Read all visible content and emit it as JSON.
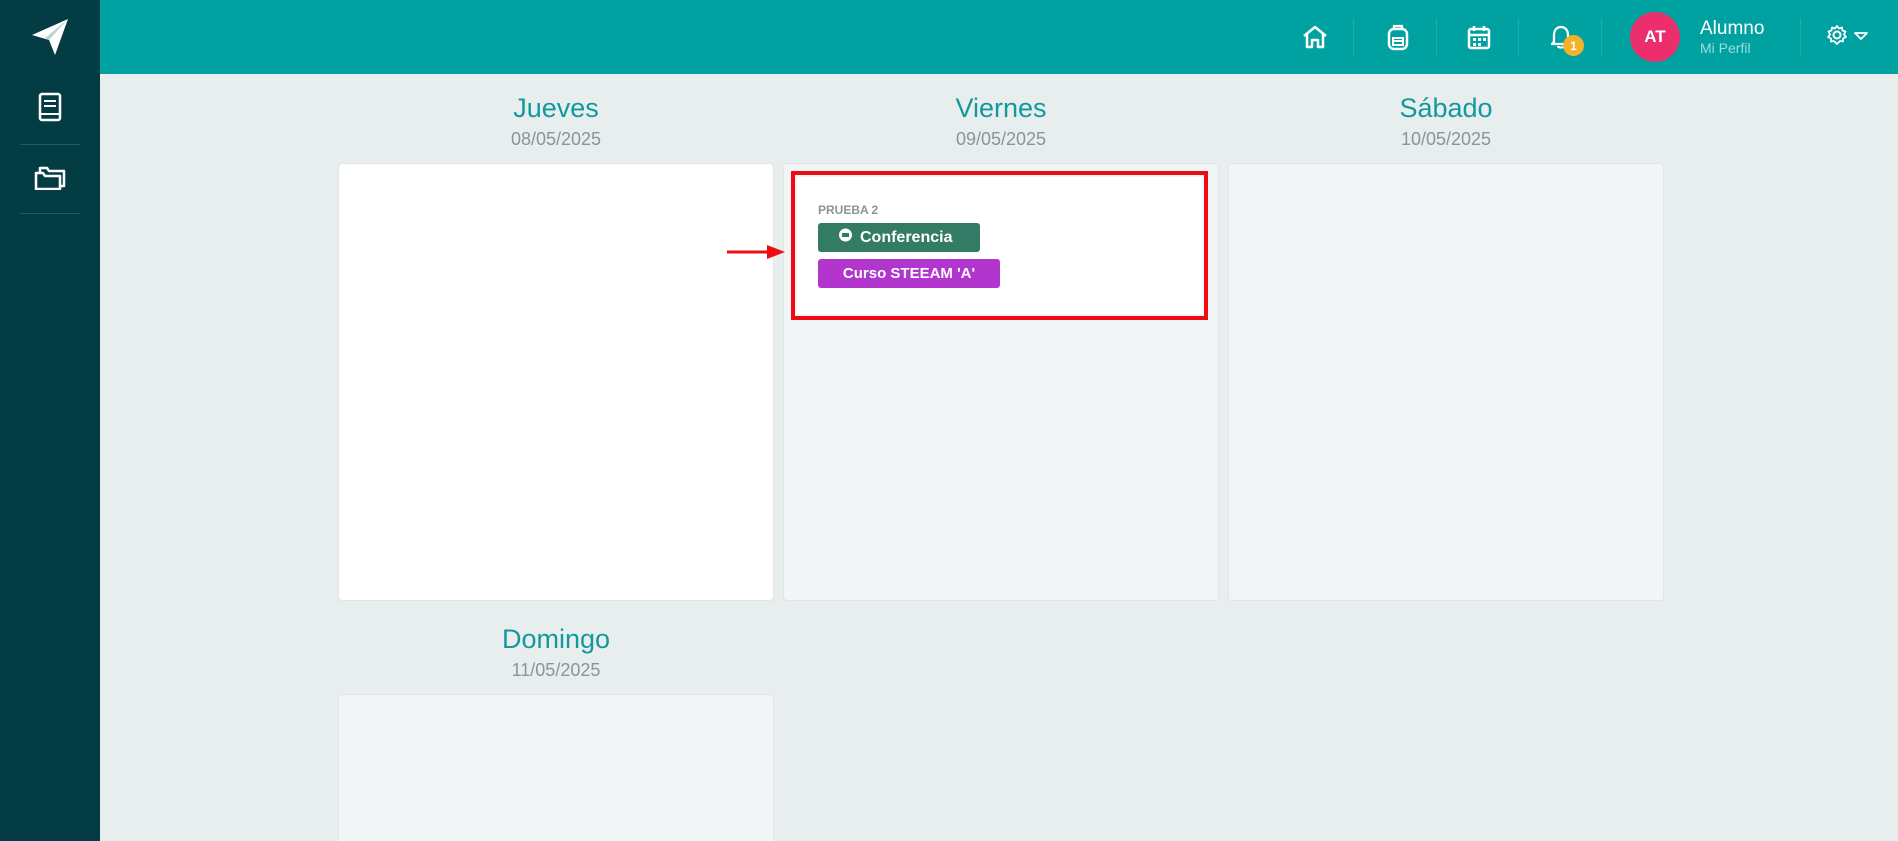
{
  "user": {
    "initials": "AT",
    "name": "Alumno",
    "subtitle": "Mi Perfil"
  },
  "notifications": {
    "count": "1"
  },
  "colors": {
    "sidebar": "#033c43",
    "topbar": "#00a1a1",
    "accent": "#13999c",
    "avatar": "#ec2f6c",
    "badge": "#f3b229",
    "conference_tag": "#347b66",
    "course_tag": "#b235ce",
    "highlight": "#ee0b13"
  },
  "topbar_icons": [
    "home-icon",
    "backpack-icon",
    "calendar-icon",
    "bell-icon",
    "gear-icon",
    "caret-down-icon"
  ],
  "sidebar_icons": [
    "paper-plane-icon",
    "book-icon",
    "folders-icon"
  ],
  "days": [
    {
      "name": "Jueves",
      "date": "08/05/2025"
    },
    {
      "name": "Viernes",
      "date": "09/05/2025"
    },
    {
      "name": "Sábado",
      "date": "10/05/2025"
    },
    {
      "name": "Domingo",
      "date": "11/05/2025"
    }
  ],
  "event": {
    "title": "PRUEBA 2",
    "type_label": "Conferencia",
    "course_label": "Curso STEEAM 'A'"
  }
}
